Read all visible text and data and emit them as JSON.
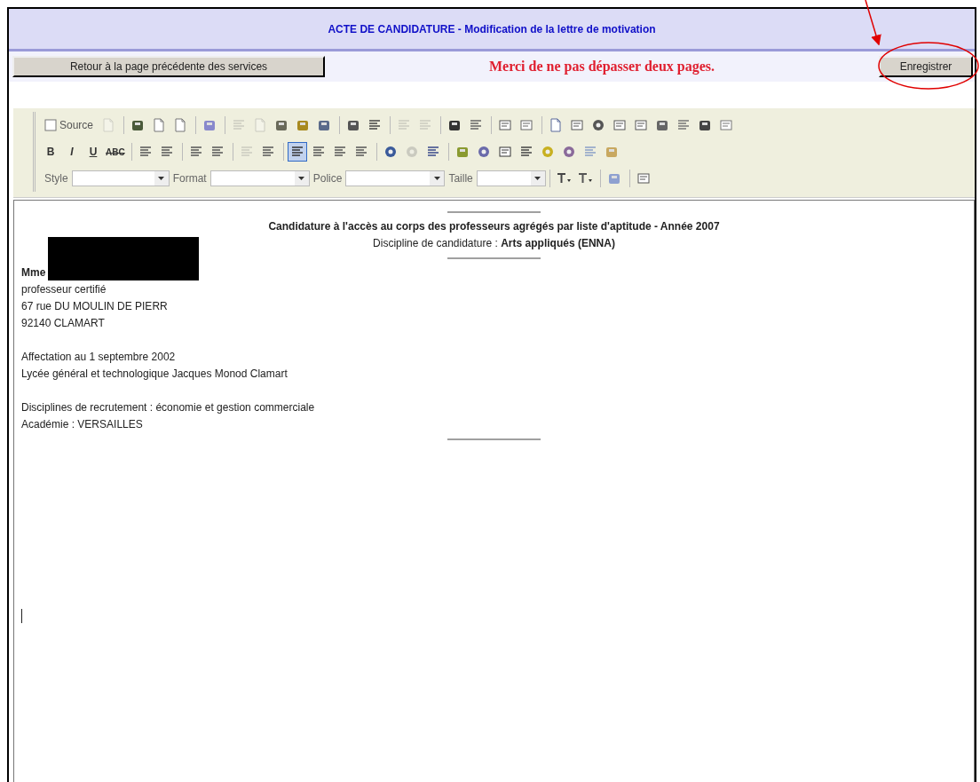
{
  "header": {
    "title": "ACTE DE CANDIDATURE - Modification de la lettre de motivation"
  },
  "actions": {
    "back_button": "Retour à la page précédente des services",
    "notice": "Merci de ne pas dépasser deux pages.",
    "save_button": "Enregistrer"
  },
  "toolbar": {
    "rows": [
      [
        {
          "kind": "text_button",
          "label": "Source",
          "selected": false,
          "disabled": false
        },
        {
          "kind": "icon",
          "selected": false,
          "disabled": true
        },
        {
          "kind": "separator"
        },
        {
          "kind": "icon",
          "selected": false,
          "disabled": false
        },
        {
          "kind": "icon",
          "selected": false,
          "disabled": false
        },
        {
          "kind": "icon",
          "selected": false,
          "disabled": false
        },
        {
          "kind": "separator"
        },
        {
          "kind": "icon",
          "selected": false,
          "disabled": false
        },
        {
          "kind": "separator"
        },
        {
          "kind": "icon",
          "selected": false,
          "disabled": true
        },
        {
          "kind": "icon",
          "selected": false,
          "disabled": true
        },
        {
          "kind": "icon",
          "selected": false,
          "disabled": false
        },
        {
          "kind": "icon",
          "selected": false,
          "disabled": false
        },
        {
          "kind": "icon",
          "selected": false,
          "disabled": false
        },
        {
          "kind": "separator"
        },
        {
          "kind": "icon",
          "selected": false,
          "disabled": false
        },
        {
          "kind": "icon",
          "selected": false,
          "disabled": false
        },
        {
          "kind": "separator"
        },
        {
          "kind": "icon",
          "selected": false,
          "disabled": true
        },
        {
          "kind": "icon",
          "selected": false,
          "disabled": true
        },
        {
          "kind": "separator"
        },
        {
          "kind": "icon",
          "selected": false,
          "disabled": false
        },
        {
          "kind": "icon",
          "selected": false,
          "disabled": false
        },
        {
          "kind": "separator"
        },
        {
          "kind": "icon",
          "selected": false,
          "disabled": false
        },
        {
          "kind": "icon",
          "selected": false,
          "disabled": false
        },
        {
          "kind": "separator"
        },
        {
          "kind": "icon",
          "selected": false,
          "disabled": false
        },
        {
          "kind": "icon",
          "selected": false,
          "disabled": false
        },
        {
          "kind": "icon",
          "selected": false,
          "disabled": false
        },
        {
          "kind": "icon",
          "selected": false,
          "disabled": false
        },
        {
          "kind": "icon",
          "selected": false,
          "disabled": false
        },
        {
          "kind": "icon",
          "selected": false,
          "disabled": false
        },
        {
          "kind": "icon",
          "selected": false,
          "disabled": false
        },
        {
          "kind": "icon",
          "selected": false,
          "disabled": false
        },
        {
          "kind": "icon",
          "selected": false,
          "disabled": false
        }
      ],
      [
        {
          "kind": "glyph",
          "text": "B",
          "selected": false,
          "disabled": false
        },
        {
          "kind": "glyph",
          "text": "I",
          "selected": false,
          "disabled": false
        },
        {
          "kind": "glyph",
          "text": "U",
          "selected": false,
          "disabled": false
        },
        {
          "kind": "glyph",
          "text": "ABC",
          "selected": false,
          "disabled": false
        },
        {
          "kind": "separator"
        },
        {
          "kind": "icon",
          "selected": false,
          "disabled": false
        },
        {
          "kind": "icon",
          "selected": false,
          "disabled": false
        },
        {
          "kind": "separator"
        },
        {
          "kind": "icon",
          "selected": false,
          "disabled": false
        },
        {
          "kind": "icon",
          "selected": false,
          "disabled": false
        },
        {
          "kind": "separator"
        },
        {
          "kind": "icon",
          "selected": false,
          "disabled": true
        },
        {
          "kind": "icon",
          "selected": false,
          "disabled": false
        },
        {
          "kind": "separator"
        },
        {
          "kind": "icon",
          "selected": true,
          "disabled": false
        },
        {
          "kind": "icon",
          "selected": false,
          "disabled": false
        },
        {
          "kind": "icon",
          "selected": false,
          "disabled": false
        },
        {
          "kind": "icon",
          "selected": false,
          "disabled": false
        },
        {
          "kind": "separator"
        },
        {
          "kind": "icon",
          "selected": false,
          "disabled": false
        },
        {
          "kind": "icon",
          "selected": false,
          "disabled": true
        },
        {
          "kind": "icon",
          "selected": false,
          "disabled": false
        },
        {
          "kind": "separator"
        },
        {
          "kind": "icon",
          "selected": false,
          "disabled": false
        },
        {
          "kind": "icon",
          "selected": false,
          "disabled": false
        },
        {
          "kind": "icon",
          "selected": false,
          "disabled": false
        },
        {
          "kind": "icon",
          "selected": false,
          "disabled": false
        },
        {
          "kind": "icon",
          "selected": false,
          "disabled": false
        },
        {
          "kind": "icon",
          "selected": false,
          "disabled": false
        },
        {
          "kind": "icon",
          "selected": false,
          "disabled": false
        },
        {
          "kind": "icon",
          "selected": false,
          "disabled": false
        }
      ],
      [
        {
          "kind": "combo",
          "label": "Style"
        },
        {
          "kind": "combo",
          "label": "Format"
        },
        {
          "kind": "combo",
          "label": "Police"
        },
        {
          "kind": "combo",
          "label": "Taille"
        },
        {
          "kind": "separator"
        },
        {
          "kind": "icon",
          "selected": false,
          "disabled": false
        },
        {
          "kind": "icon",
          "selected": false,
          "disabled": false
        },
        {
          "kind": "separator"
        },
        {
          "kind": "icon",
          "selected": false,
          "disabled": false
        },
        {
          "kind": "separator"
        },
        {
          "kind": "icon",
          "selected": false,
          "disabled": false
        }
      ]
    ]
  },
  "document": {
    "heading": "Candidature à l'accès au corps des professeurs agrégés par liste d'aptitude - Année 2007",
    "discipline": "Discipline de candidature : **Arts appliqués (ENNA)**",
    "blocks": [
      {
        "lines": [
          {
            "kind": "name",
            "text": "Mme",
            "redacted": true
          },
          {
            "kind": "plain",
            "text": "professeur certifié"
          },
          {
            "kind": "plain",
            "text": "67 rue DU MOULIN DE PIERR"
          },
          {
            "kind": "plain",
            "text": "92140 CLAMART"
          }
        ]
      },
      {
        "lines": [
          {
            "kind": "plain",
            "text": "Affectation au 1 septembre 2002"
          },
          {
            "kind": "plain",
            "text": "Lycée général et technologique Jacques Monod Clamart"
          }
        ]
      },
      {
        "lines": [
          {
            "kind": "plain",
            "text": "Disciplines de recrutement : économie et gestion commerciale"
          },
          {
            "kind": "plain",
            "text": "Académie : VERSAILLES"
          }
        ]
      }
    ]
  }
}
